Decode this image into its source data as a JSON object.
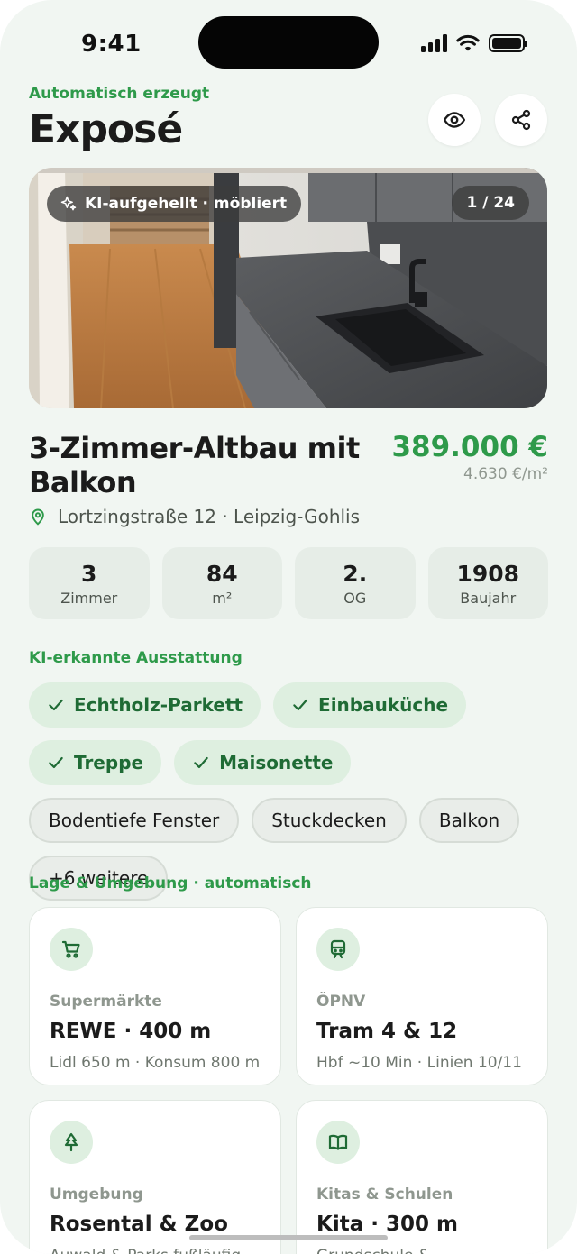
{
  "status_bar": {
    "time": "9:41"
  },
  "header": {
    "eyebrow": "Automatisch erzeugt",
    "title": "Exposé"
  },
  "actions": {
    "preview_icon": "eye-icon",
    "share_icon": "share-icon"
  },
  "hero": {
    "badge_icon": "sparkles-icon",
    "badge_label": "KI-aufgehellt · möbliert",
    "counter": "1 / 24"
  },
  "listing": {
    "title": "3-Zimmer-Altbau mit Balkon",
    "price": "389.000 €",
    "price_per_sqm": "4.630 €/m²",
    "address": "Lortzingstraße 12 · Leipzig-Gohlis"
  },
  "stats": [
    {
      "value": "3",
      "label": "Zimmer"
    },
    {
      "value": "84",
      "label": "m²"
    },
    {
      "value": "2.",
      "label": "OG"
    },
    {
      "value": "1908",
      "label": "Baujahr"
    }
  ],
  "features": {
    "section_label": "KI-erkannte Ausstattung",
    "chips": [
      {
        "label": "Echtholz-Parkett",
        "checked": true
      },
      {
        "label": "Einbauküche",
        "checked": true
      },
      {
        "label": "Treppe",
        "checked": true
      },
      {
        "label": "Maisonette",
        "checked": true
      },
      {
        "label": "Bodentiefe Fenster",
        "checked": false
      },
      {
        "label": "Stuckdecken",
        "checked": false
      },
      {
        "label": "Balkon",
        "checked": false
      },
      {
        "label": "+6 weitere",
        "checked": false
      }
    ]
  },
  "location": {
    "section_label": "Lage & Umgebung · automatisch",
    "cards": [
      {
        "icon": "cart-icon",
        "category": "Supermärkte",
        "main": "REWE · 400 m",
        "sub": "Lidl 650 m · Konsum 800 m"
      },
      {
        "icon": "train-icon",
        "category": "ÖPNV",
        "main": "Tram 4 & 12",
        "sub": "Hbf ~10 Min · Linien 10/11"
      },
      {
        "icon": "tree-icon",
        "category": "Umgebung",
        "main": "Rosental & Zoo",
        "sub": "Auwald & Parks fußläufig"
      },
      {
        "icon": "book-icon",
        "category": "Kitas & Schulen",
        "main": "Kita · 300 m",
        "sub": "Grundschule &"
      }
    ]
  },
  "colors": {
    "accent": "#2e9a4a",
    "background": "#f1f6f2",
    "chip_active": "#deefe0"
  }
}
